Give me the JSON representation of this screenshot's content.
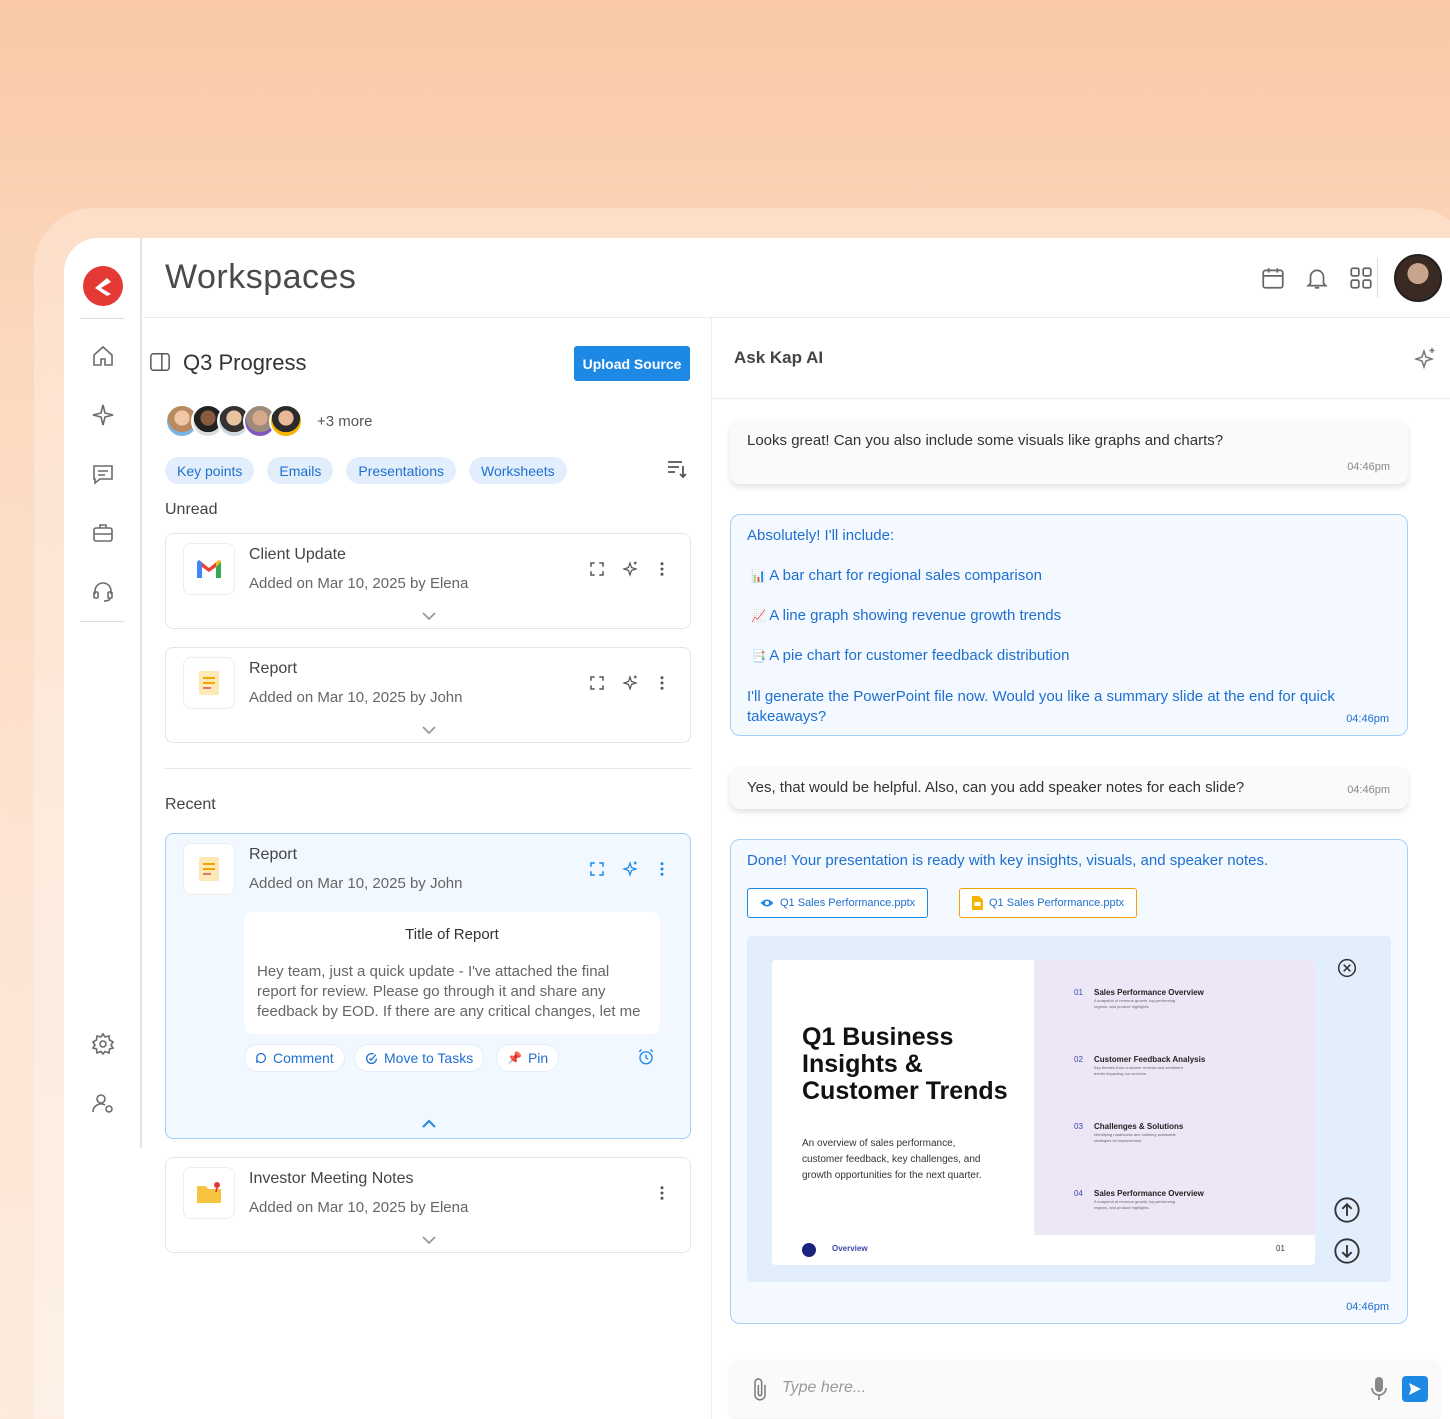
{
  "app": {
    "title": "Workspaces"
  },
  "colors": {
    "accent": "#1e88e5",
    "brand": "#e53935"
  },
  "rail": {
    "items": [
      "home-icon",
      "sparkle-icon",
      "chat-icon",
      "briefcase-icon",
      "support-icon",
      "settings-icon",
      "user-settings-icon"
    ]
  },
  "header": {
    "icons": [
      "calendar-icon",
      "bell-icon",
      "grid-icon"
    ]
  },
  "workspace": {
    "name": "Q3 Progress",
    "upload_label": "Upload Source",
    "more_members": "+3 more",
    "filters": [
      "Key points",
      "Emails",
      "Presentations",
      "Worksheets"
    ],
    "unread_label": "Unread",
    "recent_label": "Recent",
    "unread": [
      {
        "title": "Client Update",
        "meta": "Added on Mar 10, 2025 by Elena"
      },
      {
        "title": "Report",
        "meta": "Added on Mar 10, 2025 by John"
      }
    ],
    "recent": [
      {
        "title": "Report",
        "meta": "Added on Mar 10, 2025 by John",
        "preview_title": "Title of Report",
        "preview_body": "Hey team, just a quick update - I've attached the final report for review. Please go through it and share any feedback by EOD. If there are any critical changes, let me know as soon as possible.",
        "actions": [
          "Comment",
          "Move to Tasks",
          "Pin"
        ]
      },
      {
        "title": "Investor Meeting Notes",
        "meta": "Added on Mar 10, 2025 by Elena"
      }
    ]
  },
  "chat": {
    "title": "Ask Kap AI",
    "messages": [
      {
        "text": "Looks great! Can you also include some visuals like graphs and charts?",
        "time": "04:46pm"
      },
      {
        "intro": "Absolutely! I'll include:",
        "items": [
          {
            "icon": "📊",
            "text": "A bar chart for regional sales comparison"
          },
          {
            "icon": "📈",
            "text": "A line graph showing revenue growth trends"
          },
          {
            "icon": "📑",
            "text": "A pie chart for customer feedback distribution"
          }
        ],
        "outro": "I'll generate the PowerPoint file now. Would you like a summary slide at the end for quick takeaways?",
        "time": "04:46pm"
      },
      {
        "text": "Yes, that would be helpful. Also, can you add speaker notes for each slide?",
        "time": "04:46pm"
      },
      {
        "text": "Done! Your presentation is ready with key insights, visuals, and speaker notes.",
        "files": [
          "Q1 Sales Performance.pptx",
          "Q1 Sales Performance.pptx"
        ],
        "time": "04:46pm"
      }
    ],
    "slide": {
      "title": "Q1 Business Insights & Customer Trends",
      "desc": "An overview of sales performance, customer feedback, key challenges, and growth opportunities for the next quarter.",
      "footer": "Overview",
      "page": "01",
      "agenda": [
        {
          "n": "01",
          "t": "Sales Performance Overview",
          "s": "A snapshot of revenue growth, top-performing regions, and product highlights."
        },
        {
          "n": "02",
          "t": "Customer Feedback Analysis",
          "s": "Key themes from customer reviews and sentiment trends impacting our services."
        },
        {
          "n": "03",
          "t": "Challenges & Solutions",
          "s": "Identifying roadblocks and outlining actionable strategies for improvement."
        },
        {
          "n": "04",
          "t": "Sales Performance Overview",
          "s": "A snapshot of revenue growth, top-performing regions, and product highlights."
        }
      ]
    },
    "input_placeholder": "Type here..."
  }
}
